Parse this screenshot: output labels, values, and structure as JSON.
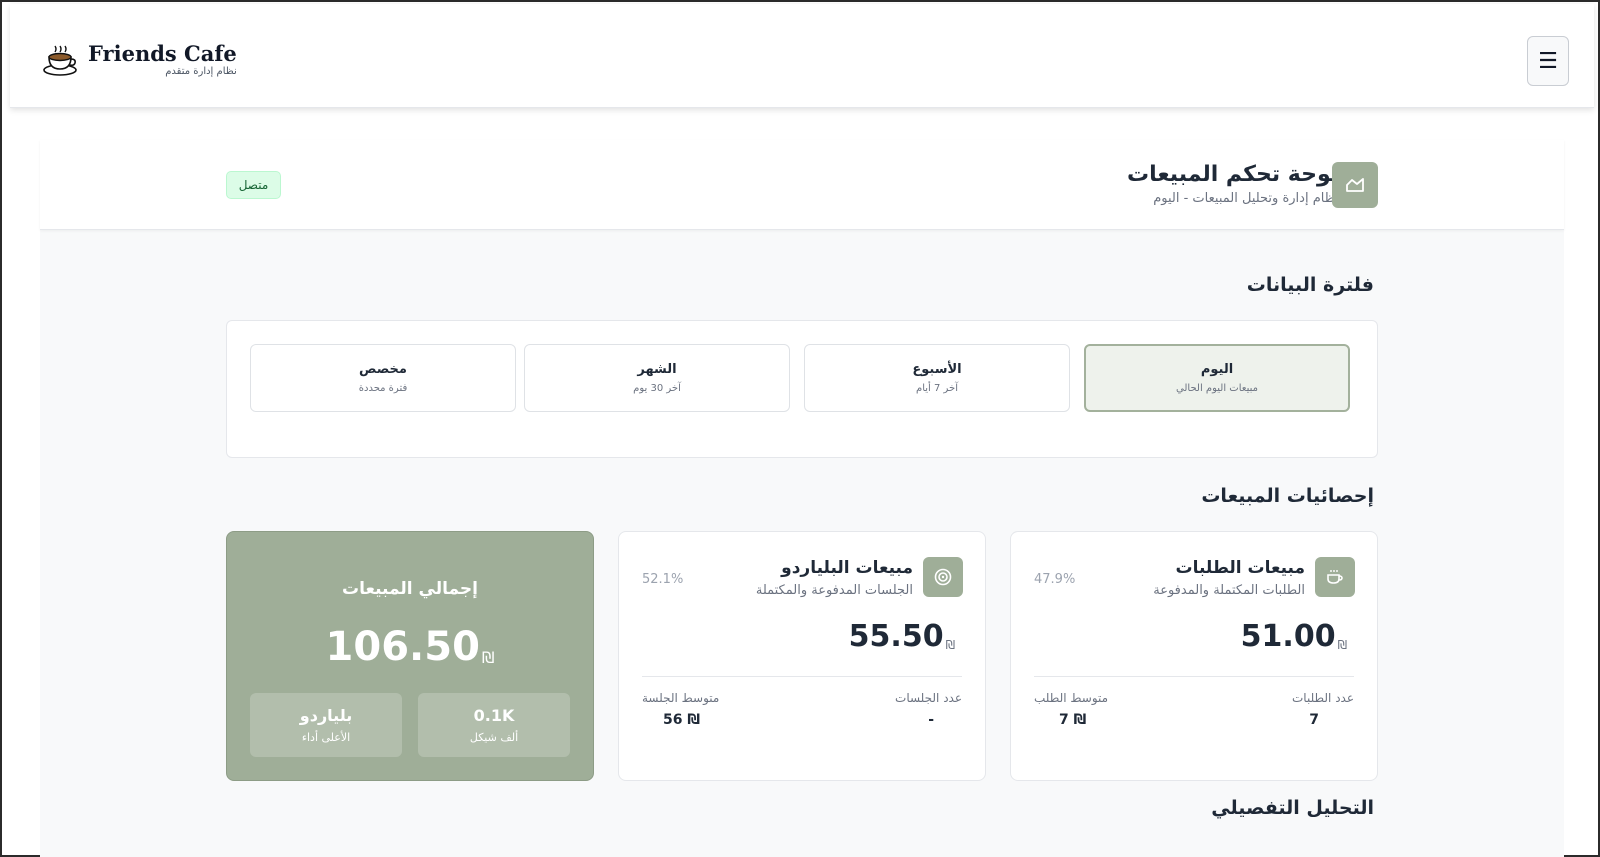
{
  "brand": {
    "name": "Friends Cafe",
    "subtitle": "نظام إدارة متقدم"
  },
  "menu": {
    "icon": "hamburger-icon",
    "glyph": "☰"
  },
  "dashboard": {
    "title": "لوحة تحكم المبيعات",
    "subtitle": "نظام إدارة وتحليل المبيعات - اليوم",
    "status": "متصل",
    "icon": "chart-icon"
  },
  "filter": {
    "title": "فلترة البيانات",
    "options": [
      {
        "label": "اليوم",
        "desc": "مبيعات اليوم الحالي",
        "active": true
      },
      {
        "label": "الأسبوع",
        "desc": "آخر 7 أيام",
        "active": false
      },
      {
        "label": "الشهر",
        "desc": "آخر 30 يوم",
        "active": false
      },
      {
        "label": "مخصص",
        "desc": "فترة محددة",
        "active": false
      }
    ]
  },
  "stats": {
    "title": "إحصائيات المبيعات",
    "currency": "₪",
    "orders": {
      "title": "مبيعات الطلبات",
      "subtitle": "الطلبات المكتملة والمدفوعة",
      "percent": "47.9%",
      "amount": "51.00",
      "count_label": "عدد الطلبات",
      "count_value": "7",
      "avg_label": "متوسط الطلب",
      "avg_value": "7 ₪"
    },
    "billiards": {
      "title": "مبيعات البلياردو",
      "subtitle": "الجلسات المدفوعة والمكتملة",
      "percent": "52.1%",
      "amount": "55.50",
      "count_label": "عدد الجلسات",
      "count_value": "-",
      "avg_label": "متوسط الجلسة",
      "avg_value": "56 ₪"
    },
    "total": {
      "title": "إجمالي المبيعات",
      "amount": "106.50",
      "mini_left_value": "بلياردو",
      "mini_left_label": "الأعلى أداء",
      "mini_right_value": "0.1K",
      "mini_right_label": "ألف شيكل"
    }
  },
  "analysis": {
    "title": "التحليل التفصيلي"
  },
  "colors": {
    "accent": "#9fae98",
    "status_bg": "#dcfce7",
    "status_text": "#166534"
  }
}
